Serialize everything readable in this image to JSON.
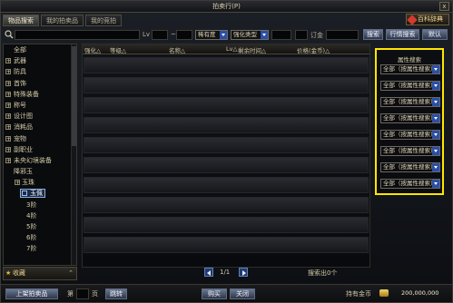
{
  "window": {
    "title": "拍卖行(P)",
    "close_label": "x"
  },
  "tabs": [
    {
      "label": "物品搜索"
    },
    {
      "label": "我的拍卖品"
    },
    {
      "label": "我的竞拍"
    }
  ],
  "gem_button": "百科辞典",
  "search": {
    "placeholder": "",
    "level_label": "Lv",
    "level_separator": "~",
    "rarity_select": "稀有度",
    "enhance_select": "强化类型",
    "deposit_label": "订金",
    "search_button": "搜索",
    "advanced_button": "行情搜索",
    "reset_button": "默认"
  },
  "categories": [
    {
      "label": "全部",
      "type": "plain"
    },
    {
      "label": "武器",
      "type": "box"
    },
    {
      "label": "防具",
      "type": "box"
    },
    {
      "label": "首饰",
      "type": "box"
    },
    {
      "label": "特殊装备",
      "type": "box"
    },
    {
      "label": "称号",
      "type": "box"
    },
    {
      "label": "设计图",
      "type": "box"
    },
    {
      "label": "消耗品",
      "type": "box"
    },
    {
      "label": "宠物",
      "type": "box"
    },
    {
      "label": "副职业",
      "type": "box"
    },
    {
      "label": "未央幻境装备",
      "type": "box"
    },
    {
      "label": "降邪玉",
      "type": "plain"
    },
    {
      "label": "玉珠",
      "type": "sub"
    },
    {
      "label": "玉佩",
      "type": "selected"
    },
    {
      "label": "3阶",
      "type": "plain2"
    },
    {
      "label": "4阶",
      "type": "plain2"
    },
    {
      "label": "5阶",
      "type": "plain2"
    },
    {
      "label": "6阶",
      "type": "plain2"
    },
    {
      "label": "7阶",
      "type": "plain2"
    }
  ],
  "favorites_label": "收藏",
  "table": {
    "headers": [
      "强化△",
      "等级△",
      "名称△",
      "Lv△",
      "剩余时间△",
      "价格(金币)△"
    ]
  },
  "pager": {
    "text": "1/1"
  },
  "found_text": "搜索出0个",
  "bottom": {
    "list_button": "上架拍卖品",
    "page_prefix": "第",
    "page_suffix": "页",
    "goto_button": "跳转",
    "buy_button": "购买",
    "close_button": "关闭",
    "gold_label": "持有金币",
    "gold_value": "200,000,000"
  },
  "attribute_panel": {
    "title": "属性搜索",
    "options": [
      "全部（按属性搜索）",
      "全部（按属性搜索）",
      "全部（按属性搜索）",
      "全部（按属性搜索）",
      "全部（按属性搜索）",
      "全部（按属性搜索）",
      "全部（按属性搜索）",
      "全部（按属性搜索）"
    ],
    "highlight_color": "#ffe600"
  }
}
